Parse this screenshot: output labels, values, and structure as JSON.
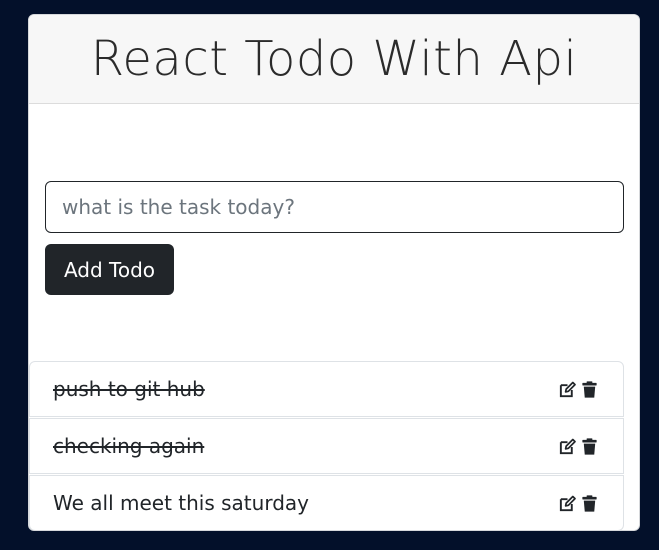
{
  "header": {
    "title": "React Todo With Api"
  },
  "form": {
    "input_value": "",
    "input_placeholder": "what is the task today?",
    "add_button_label": "Add Todo"
  },
  "todos": [
    {
      "text": "push to git hub",
      "completed": true
    },
    {
      "text": "checking again",
      "completed": true
    },
    {
      "text": "We all meet this saturday",
      "completed": false
    }
  ],
  "icons": {
    "edit": "edit-icon",
    "delete": "trash-icon"
  },
  "colors": {
    "page_background": "#03102a",
    "button_background": "#212529",
    "text": "#212529"
  }
}
